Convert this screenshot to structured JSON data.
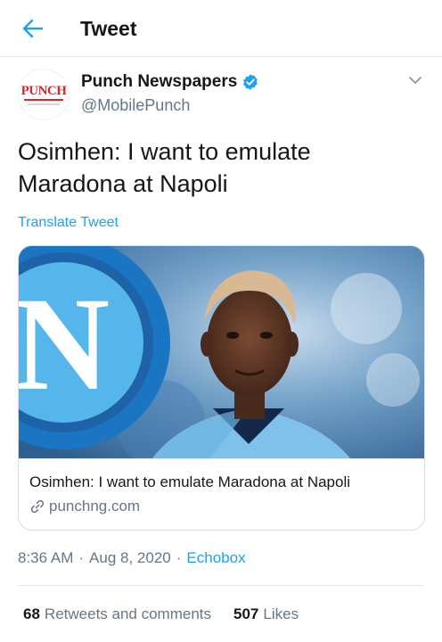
{
  "header": {
    "title": "Tweet",
    "back_icon": "arrow-left-icon"
  },
  "tweet": {
    "author": {
      "name": "Punch Newspapers",
      "handle": "@MobilePunch",
      "avatar_logo_text": "PUNCH",
      "verified": true
    },
    "text": "Osimhen: I want to emulate Maradona at Napoli",
    "translate_label": "Translate Tweet",
    "card": {
      "title": "Osimhen: I want to emulate Maradona at Napoli",
      "domain": "punchng.com",
      "image_letter": "N"
    },
    "time": "8:36 AM",
    "date": "Aug 8, 2020",
    "separator": "·",
    "source": "Echobox",
    "stats": {
      "retweets_count": "68",
      "retweets_label": "Retweets and comments",
      "likes_count": "507",
      "likes_label": "Likes"
    }
  },
  "colors": {
    "accent": "#1da1f2",
    "secondary_text": "#657786",
    "brand_red": "#e0232b",
    "napoli_blue": "#1a75c2"
  }
}
